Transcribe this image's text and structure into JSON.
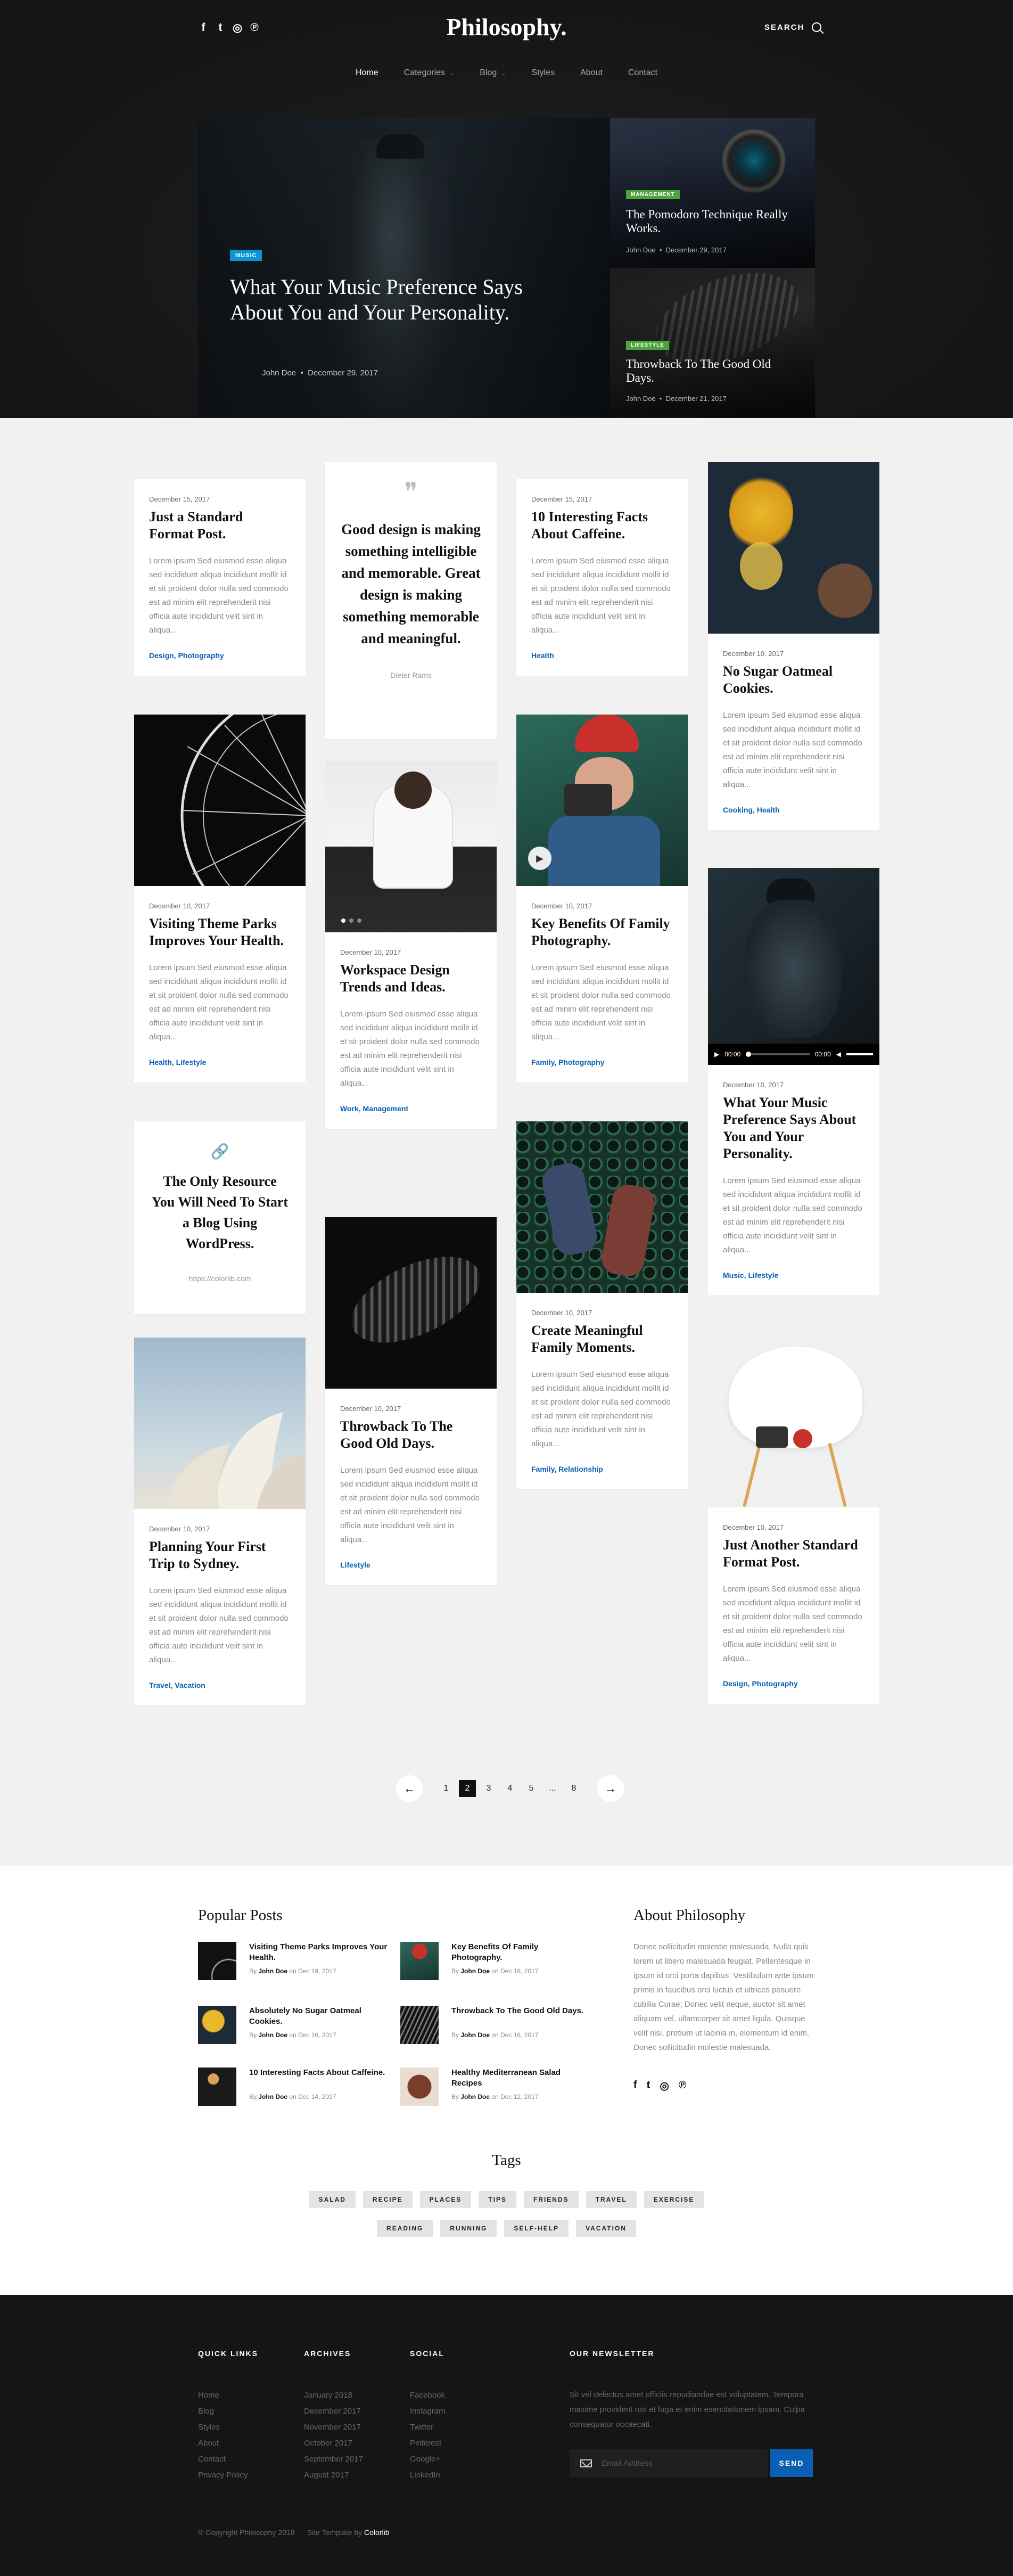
{
  "header": {
    "social_icons": [
      "facebook-icon",
      "twitter-icon",
      "instagram-icon",
      "pinterest-icon"
    ],
    "social_glyphs": [
      "f",
      "t",
      "◎",
      "℗"
    ],
    "logo": "Philosophy.",
    "search_label": "SEARCH",
    "nav": [
      {
        "label": "Home",
        "dropdown": false
      },
      {
        "label": "Categories",
        "dropdown": true
      },
      {
        "label": "Blog",
        "dropdown": true
      },
      {
        "label": "Styles",
        "dropdown": false
      },
      {
        "label": "About",
        "dropdown": false
      },
      {
        "label": "Contact",
        "dropdown": false
      }
    ],
    "chevron": "⌄"
  },
  "hero": {
    "main": {
      "badge": "MUSIC",
      "title": "What Your Music Preference Says About You and Your Personality.",
      "author": "John Doe",
      "date": "December 29, 2017"
    },
    "side": [
      {
        "badge": "MANAGEMENT",
        "title": "The Pomodoro Technique Really Works.",
        "author": "John Doe",
        "date": "December 29, 2017"
      },
      {
        "badge": "LIFESTYLE",
        "title": "Throwback To The Good Old Days.",
        "author": "John Doe",
        "date": "December 21, 2017"
      }
    ]
  },
  "lorem": "Lorem ipsum Sed eiusmod esse aliqua sed incididunt aliqua incididunt mollit id et sit proident dolor nulla sed commodo est ad minim elit reprehenderit nisi officia aute incididunt velit sint in aliqua...",
  "cards": {
    "c1": {
      "date": "December 15, 2017",
      "title": "Just a Standard Format Post.",
      "tags": "Design, Photography"
    },
    "quote": {
      "mark": "❞",
      "text": "Good design is making something intelligible and memorable. Great design is making something memorable and meaningful.",
      "author": "Dieter Rams"
    },
    "c3": {
      "date": "December 15, 2017",
      "title": "10 Interesting Facts About Caffeine.",
      "tags": "Health"
    },
    "c4": {
      "date": "December 10, 2017",
      "title": "No Sugar Oatmeal Cookies.",
      "tags": "Cooking, Health"
    },
    "c5": {
      "date": "December 10, 2017",
      "title": "Visiting Theme Parks Improves Your Health.",
      "tags": "Health, Lifestyle"
    },
    "c6": {
      "date": "December 10, 2017",
      "title": "Workspace Design Trends and Ideas.",
      "tags": "Work, Management"
    },
    "c7": {
      "date": "December 10, 2017",
      "title": "Key Benefits Of Family Photography.",
      "tags": "Family, Photography"
    },
    "c8": {
      "date": "December 10, 2017",
      "title": "What Your Music Preference Says About You and Your Personality.",
      "tags": "Music, Lifestyle",
      "player_time": "00:00",
      "player_dur": "00:00"
    },
    "link": {
      "icon": "🔗",
      "text": "The Only Resource You Will Need To Start a Blog Using WordPress.",
      "url": "https://colorlib.com"
    },
    "c10": {
      "date": "December 10, 2017",
      "title": "Throwback To The Good Old Days.",
      "tags": "Lifestyle"
    },
    "c11": {
      "date": "December 10, 2017",
      "title": "Create Meaningful Family Moments.",
      "tags": "Family, Relationship"
    },
    "c12": {
      "date": "December 10, 2017",
      "title": "Planning Your First Trip to Sydney.",
      "tags": "Travel, Vacation"
    },
    "c13": {
      "date": "December 10, 2017",
      "title": "Just Another Standard Format Post.",
      "tags": "Design, Photography"
    }
  },
  "pagination": {
    "prev": "←",
    "next": "→",
    "pages": [
      "1",
      "2",
      "3",
      "4",
      "5",
      "...",
      "8"
    ],
    "current": "2"
  },
  "popular": {
    "heading": "Popular Posts",
    "by": "By",
    "on": "on",
    "posts": [
      {
        "title": "Visiting Theme Parks Improves Your Health.",
        "author": "John Doe",
        "date": "Dec 19, 2017"
      },
      {
        "title": "Key Benefits Of Family Photography.",
        "author": "John Doe",
        "date": "Dec 18, 2017"
      },
      {
        "title": "Absolutely No Sugar Oatmeal Cookies.",
        "author": "John Doe",
        "date": "Dec 16, 2017"
      },
      {
        "title": "Throwback To The Good Old Days.",
        "author": "John Doe",
        "date": "Dec 16, 2017"
      },
      {
        "title": "10 Interesting Facts About Caffeine.",
        "author": "John Doe",
        "date": "Dec 14, 2017"
      },
      {
        "title": "Healthy Mediterranean Salad Recipes",
        "author": "John Doe",
        "date": "Dec 12, 2017"
      }
    ]
  },
  "about": {
    "heading": "About Philosophy",
    "text": "Donec sollicitudin molestie malesuada. Nulla quis lorem ut libero malesuada feugiat. Pellentesque in ipsum id orci porta dapibus. Vestibulum ante ipsum primis in faucibus orci luctus et ultrices posuere cubilia Curae; Donec velit neque, auctor sit amet aliquam vel, ullamcorper sit amet ligula. Quisque velit nisi, pretium ut lacinia in, elementum id enim. Donec sollicitudin molestie malesuada."
  },
  "tags": {
    "heading": "Tags",
    "row1": [
      "SALAD",
      "RECIPE",
      "PLACES",
      "TIPS",
      "FRIENDS",
      "TRAVEL",
      "EXERCISE"
    ],
    "row2": [
      "READING",
      "RUNNING",
      "SELF-HELP",
      "VACATION"
    ]
  },
  "footer": {
    "quick_links": {
      "heading": "QUICK LINKS",
      "items": [
        "Home",
        "Blog",
        "Styles",
        "About",
        "Contact",
        "Privacy Policy"
      ]
    },
    "archives": {
      "heading": "ARCHIVES",
      "items": [
        "January 2018",
        "December 2017",
        "November 2017",
        "October 2017",
        "September 2017",
        "August 2017"
      ]
    },
    "social": {
      "heading": "SOCIAL",
      "items": [
        "Facebook",
        "Instagram",
        "Twitter",
        "Pinterest",
        "Google+",
        "LinkedIn"
      ]
    },
    "newsletter": {
      "heading": "OUR NEWSLETTER",
      "text": "Sit vel delectus amet officiis repudiandae est voluptatem. Tempora maxime provident nisi et fuga et enim exercitationem ipsam. Culpa consequatur occaecati.",
      "placeholder": "Email Address",
      "button": "SEND"
    },
    "copyright": "© Copyright Philosophy 2018",
    "template_prefix": "Site Template by",
    "template_by": "Colorlib"
  },
  "colors": {
    "accent": "#0a5fb5",
    "music_badge": "#0a96d4",
    "green_badge": "#4ca53a",
    "dark": "#151515"
  }
}
